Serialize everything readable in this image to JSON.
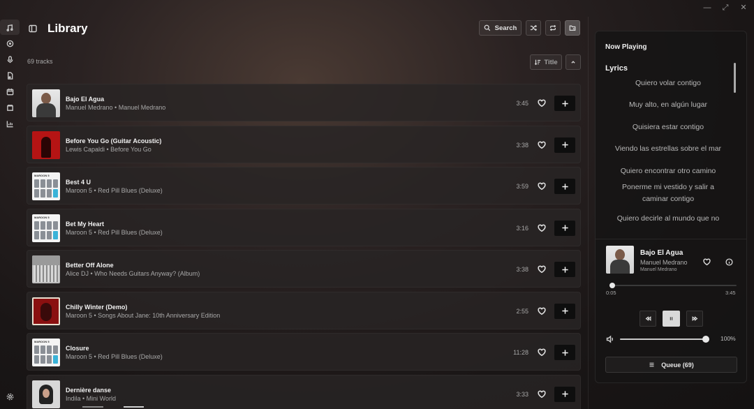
{
  "header": {
    "title": "Library",
    "search_label": "Search",
    "track_count": "69 tracks",
    "sort_label": "Title"
  },
  "tracks": [
    {
      "title": "Bajo El Agua",
      "subtitle": "Manuel Medrano • Manuel Medrano",
      "duration": "3:45",
      "cover": "man"
    },
    {
      "title": "Before You Go (Guitar Acoustic)",
      "subtitle": "Lewis Capaldi • Before You Go",
      "duration": "3:38",
      "cover": "red"
    },
    {
      "title": "Best 4 U",
      "subtitle": "Maroon 5 • Red Pill Blues (Deluxe)",
      "duration": "3:59",
      "cover": "maroon"
    },
    {
      "title": "Bet My Heart",
      "subtitle": "Maroon 5 • Red Pill Blues (Deluxe)",
      "duration": "3:16",
      "cover": "maroon"
    },
    {
      "title": "Better Off Alone",
      "subtitle": "Alice DJ • Who Needs Guitars Anyway? (Album)",
      "duration": "3:38",
      "cover": "alice"
    },
    {
      "title": "Chilly Winter (Demo)",
      "subtitle": "Maroon 5 • Songs About Jane: 10th Anniversary Edition",
      "duration": "2:55",
      "cover": "chilly"
    },
    {
      "title": "Closure",
      "subtitle": "Maroon 5 • Red Pill Blues (Deluxe)",
      "duration": "11:28",
      "cover": "maroon"
    },
    {
      "title": "Dernière danse",
      "subtitle": "Indila • Mini World",
      "duration": "3:33",
      "cover": "indila"
    }
  ],
  "cover_labels": {
    "maroon": "MAROON 5"
  },
  "now_playing": {
    "heading": "Now Playing",
    "lyrics_heading": "Lyrics",
    "lyrics": [
      "Quiero volar contigo",
      "Muy alto, en algún lugar",
      "Quisiera estar contigo",
      "Viendo las estrellas sobre el mar",
      "Quiero encontrar otro camino",
      "Ponerme mi vestido y salir a caminar contigo",
      "Quiero decirle al mundo que no"
    ],
    "song": "Bajo El Agua",
    "artist": "Manuel Medrano",
    "album": "Manuel Medrano",
    "time_current": "0:05",
    "time_total": "3:45",
    "progress_fraction": 0.02,
    "volume_label": "100%",
    "volume_fraction": 1.0,
    "queue_label": "Queue (69)"
  },
  "icons": {
    "rail": [
      "music-library-icon",
      "disc-icon",
      "microphone-icon",
      "file-music-icon",
      "calendar-icon",
      "folder-icon",
      "stats-icon"
    ],
    "settings": "settings-icon"
  }
}
